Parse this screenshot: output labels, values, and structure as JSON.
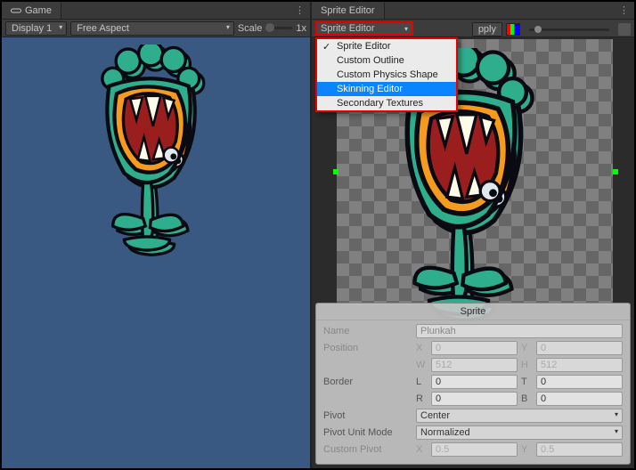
{
  "game_panel": {
    "tab_label": "Game",
    "display_dd": "Display 1",
    "aspect_dd": "Free Aspect",
    "scale_label": "Scale",
    "scale_value": "1x"
  },
  "sprite_editor_panel": {
    "tab_label": "Sprite Editor",
    "mode_button": "Sprite Editor",
    "apply_label": "pply",
    "dropdown_items": [
      {
        "label": "Sprite Editor",
        "checked": true,
        "highlighted": false
      },
      {
        "label": "Custom Outline",
        "checked": false,
        "highlighted": false
      },
      {
        "label": "Custom Physics Shape",
        "checked": false,
        "highlighted": false
      },
      {
        "label": "Skinning Editor",
        "checked": false,
        "highlighted": true
      },
      {
        "label": "Secondary Textures",
        "checked": false,
        "highlighted": false
      }
    ]
  },
  "inspector": {
    "title": "Sprite",
    "name_label": "Name",
    "name_value": "Plunkah",
    "position_label": "Position",
    "pos_x": "0",
    "pos_y": "0",
    "pos_w": "512",
    "pos_h": "512",
    "border_label": "Border",
    "b_l": "0",
    "b_t": "0",
    "b_r": "0",
    "b_b": "0",
    "pivot_label": "Pivot",
    "pivot_value": "Center",
    "pivot_mode_label": "Pivot Unit Mode",
    "pivot_mode_value": "Normalized",
    "custom_pivot_label": "Custom Pivot",
    "cp_x": "0.5",
    "cp_y": "0.5"
  }
}
